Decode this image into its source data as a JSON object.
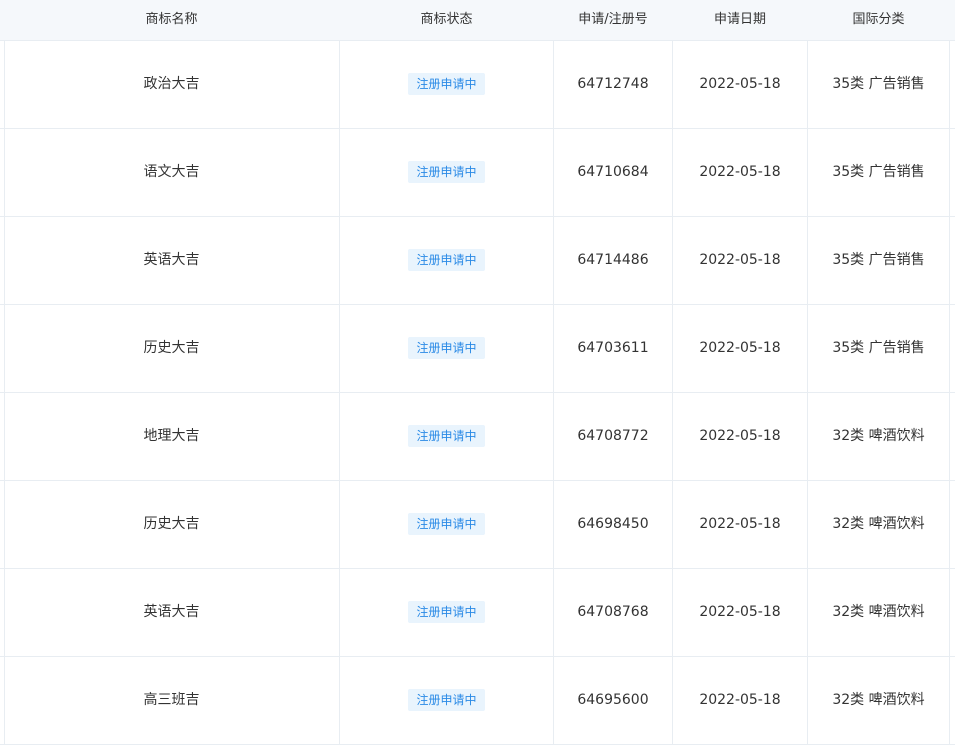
{
  "table": {
    "headers": {
      "name": "商标名称",
      "status": "商标状态",
      "reg_no": "申请/注册号",
      "date": "申请日期",
      "class": "国际分类"
    },
    "rows": [
      {
        "name": "政治大吉",
        "status": "注册申请中",
        "reg_no": "64712748",
        "date": "2022-05-18",
        "class": "35类 广告销售"
      },
      {
        "name": "语文大吉",
        "status": "注册申请中",
        "reg_no": "64710684",
        "date": "2022-05-18",
        "class": "35类 广告销售"
      },
      {
        "name": "英语大吉",
        "status": "注册申请中",
        "reg_no": "64714486",
        "date": "2022-05-18",
        "class": "35类 广告销售"
      },
      {
        "name": "历史大吉",
        "status": "注册申请中",
        "reg_no": "64703611",
        "date": "2022-05-18",
        "class": "35类 广告销售"
      },
      {
        "name": "地理大吉",
        "status": "注册申请中",
        "reg_no": "64708772",
        "date": "2022-05-18",
        "class": "32类 啤酒饮料"
      },
      {
        "name": "历史大吉",
        "status": "注册申请中",
        "reg_no": "64698450",
        "date": "2022-05-18",
        "class": "32类 啤酒饮料"
      },
      {
        "name": "英语大吉",
        "status": "注册申请中",
        "reg_no": "64708768",
        "date": "2022-05-18",
        "class": "32类 啤酒饮料"
      },
      {
        "name": "高三班吉",
        "status": "注册申请中",
        "reg_no": "64695600",
        "date": "2022-05-18",
        "class": "32类 啤酒饮料"
      }
    ]
  },
  "colors": {
    "header_bg": "#f5f8fb",
    "border": "#e8edf2",
    "badge_text": "#2a8ae6",
    "badge_bg": "#e9f4fd",
    "text": "#333333"
  }
}
